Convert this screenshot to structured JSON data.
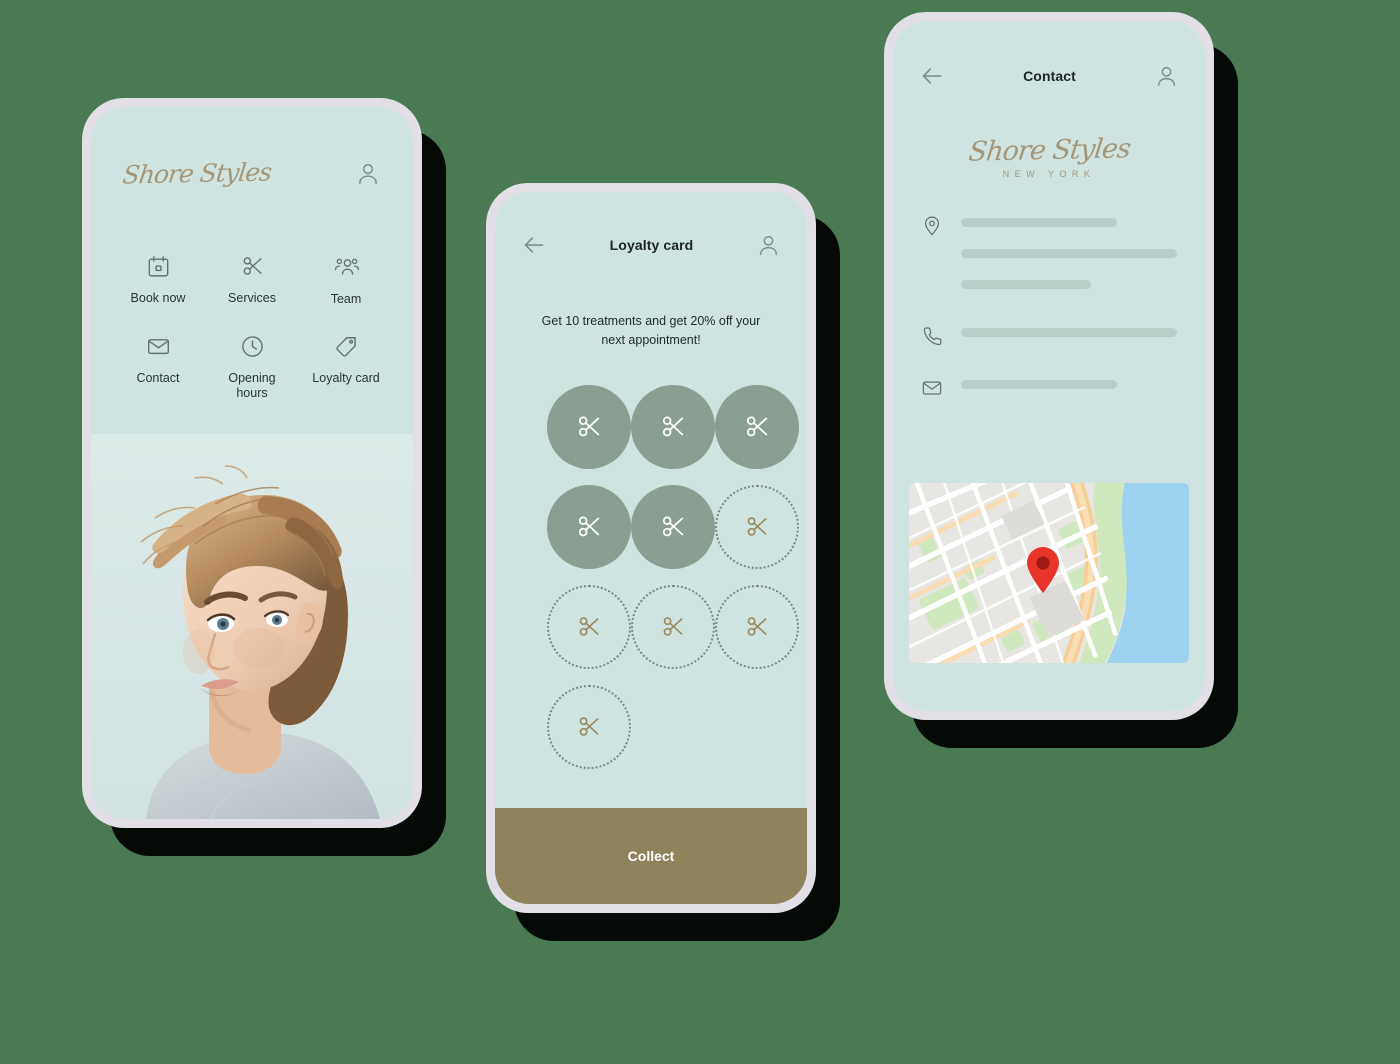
{
  "theme": {
    "page_bg": "#4a7a53",
    "screen_bg": "#cfe4e1",
    "frame": "#e2e0e6",
    "accent_gold": "#8e835b",
    "brand_gold": "#a59677",
    "stamp_filled": "#8a9f91",
    "stamp_empty_border": "#7b8a80",
    "line_placeholder": "#b9cdc9",
    "text_dark": "#1d2422",
    "map_pin": "#e8342a"
  },
  "brand": {
    "name": "Shore Styles",
    "location": "NEW YORK"
  },
  "home": {
    "profile_icon": "user-icon",
    "menu": [
      {
        "label": "Book now",
        "icon": "calendar-icon"
      },
      {
        "label": "Services",
        "icon": "scissors-icon"
      },
      {
        "label": "Team",
        "icon": "people-icon"
      },
      {
        "label": "Contact",
        "icon": "envelope-icon"
      },
      {
        "label": "Opening\nhours",
        "icon": "clock-icon"
      },
      {
        "label": "Loyalty\ncard",
        "icon": "tag-icon"
      }
    ],
    "hero_alt": "woman with short blonde pixie haircut"
  },
  "loyalty": {
    "back_icon": "back-arrow-icon",
    "title": "Loyalty card",
    "profile_icon": "user-icon",
    "promo": "Get 10 treatments and get 20% off your next appointment!",
    "total_stamps": 10,
    "collected_stamps": 5,
    "stamp_icon": "scissors-icon",
    "collect_label": "Collect"
  },
  "contact": {
    "back_icon": "back-arrow-icon",
    "title": "Contact",
    "profile_icon": "user-icon",
    "rows": [
      {
        "icon": "location-pin-icon",
        "line_widths": [
          "72%",
          "100%",
          "60%"
        ]
      },
      {
        "icon": "phone-icon",
        "line_widths": [
          "100%"
        ]
      },
      {
        "icon": "envelope-icon",
        "line_widths": [
          "72%"
        ]
      }
    ],
    "map": {
      "pin_icon": "map-pin-icon",
      "alt": "street map with location marker"
    }
  }
}
